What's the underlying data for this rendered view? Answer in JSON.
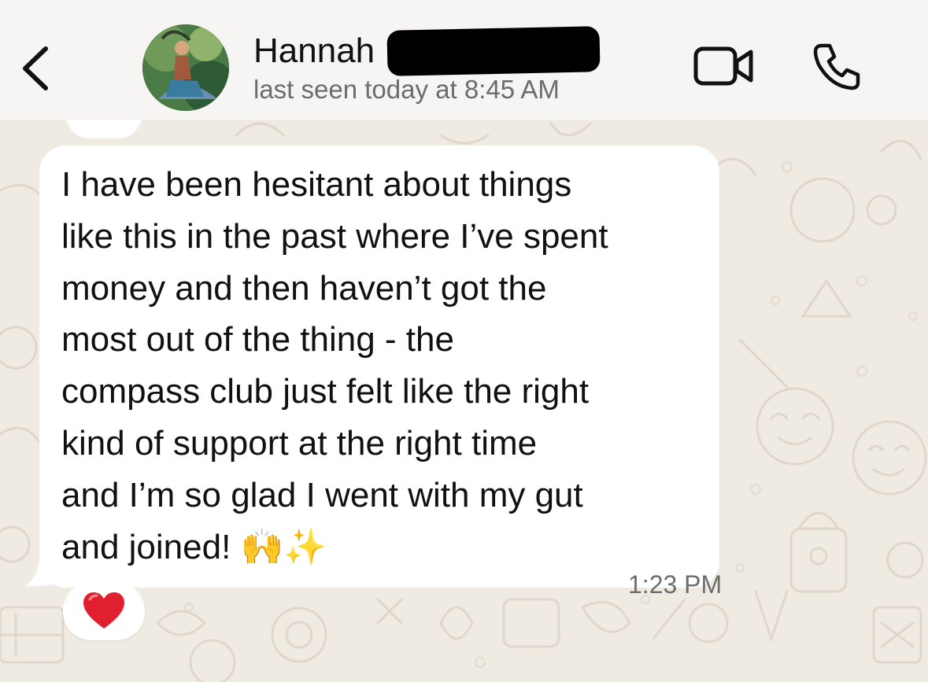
{
  "header": {
    "contact_name": "Hannah",
    "status": "last seen today at 8:45 AM"
  },
  "message": {
    "text": "I have been hesitant about things\nlike this in the past where I’ve spent\nmoney and then haven’t got the\nmost out of the thing - the\ncompass club just felt like the right\nkind of support at the right time\nand I’m so glad I went with my gut\nand joined! 🙌✨",
    "time": "1:23 PM",
    "reaction": "❤️"
  },
  "icons": {
    "back": "chevron-left-icon",
    "video": "video-camera-icon",
    "call": "phone-icon",
    "reaction": "red-heart-icon"
  },
  "colors": {
    "wallpaper": "#efeae2",
    "header": "#f6f5f3",
    "bubble": "#ffffff",
    "heart": "#e0202e"
  }
}
